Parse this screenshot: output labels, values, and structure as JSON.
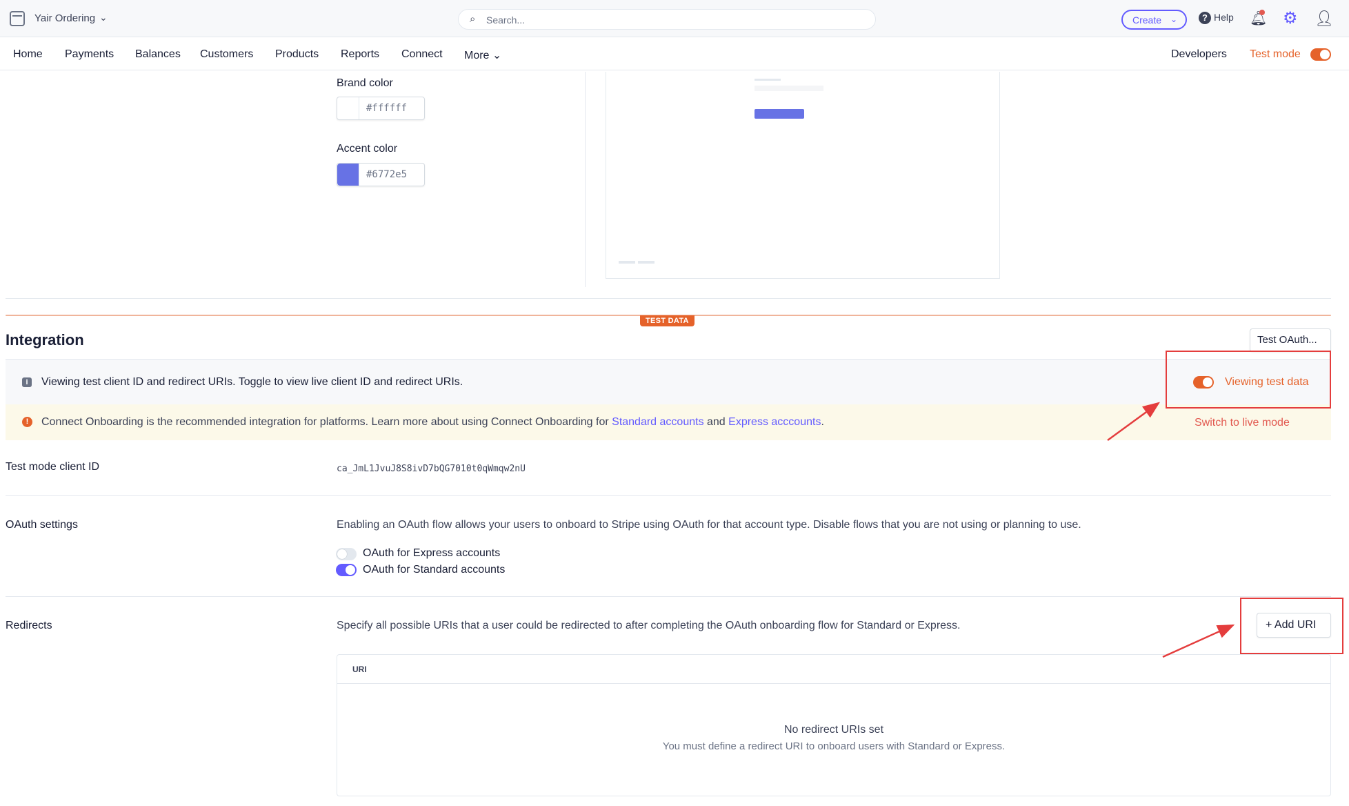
{
  "topbar": {
    "account_name": "Yair Ordering",
    "search_placeholder": "Search...",
    "create_label": "Create",
    "help_label": "Help"
  },
  "nav": {
    "items": [
      "Home",
      "Payments",
      "Balances",
      "Customers",
      "Products",
      "Reports",
      "Connect",
      "More"
    ],
    "developers_label": "Developers",
    "test_mode_label": "Test mode",
    "test_mode_on": true
  },
  "branding": {
    "brand_color_label": "Brand color",
    "brand_color_value": "#ffffff",
    "accent_color_label": "Accent color",
    "accent_color_value": "#6772e5"
  },
  "integration": {
    "badge": "TEST DATA",
    "title": "Integration",
    "test_oauth_label": "Test OAuth...",
    "info_text": "Viewing test client ID and redirect URIs. Toggle to view live client ID and redirect URIs.",
    "viewing_label": "Viewing test data",
    "warning_prefix": "Connect Onboarding is the recommended integration for platforms. Learn more about using Connect Onboarding for ",
    "warning_link1": "Standard accounts",
    "warning_mid": " and ",
    "warning_link2": "Express acccounts",
    "warning_suffix": ".",
    "annotation": "Switch to live mode"
  },
  "client_id": {
    "label": "Test mode client ID",
    "value": "ca_JmL1JvuJ8S8ivD7bQG7010t0qWmqw2nU"
  },
  "oauth": {
    "label": "OAuth settings",
    "description": "Enabling an OAuth flow allows your users to onboard to Stripe using OAuth for that account type. Disable flows that you are not using or planning to use.",
    "express_label": "OAuth for Express accounts",
    "express_enabled": false,
    "standard_label": "OAuth for Standard accounts",
    "standard_enabled": true
  },
  "redirects": {
    "label": "Redirects",
    "description": "Specify all possible URIs that a user could be redirected to after completing the OAuth onboarding flow for Standard or Express.",
    "add_label": "Add URI",
    "column_header": "URI",
    "empty_title": "No redirect URIs set",
    "empty_subtitle": "You must define a redirect URI to onboard users with Standard or Express."
  },
  "colors": {
    "accent": "#635bff",
    "test_orange": "#e5622a",
    "annotation_red": "#e43d3d"
  },
  "icons": [
    "account-icon",
    "search-icon",
    "help-icon",
    "bell-icon",
    "gear-icon",
    "user-icon",
    "info-icon",
    "warning-icon",
    "plus-icon"
  ]
}
